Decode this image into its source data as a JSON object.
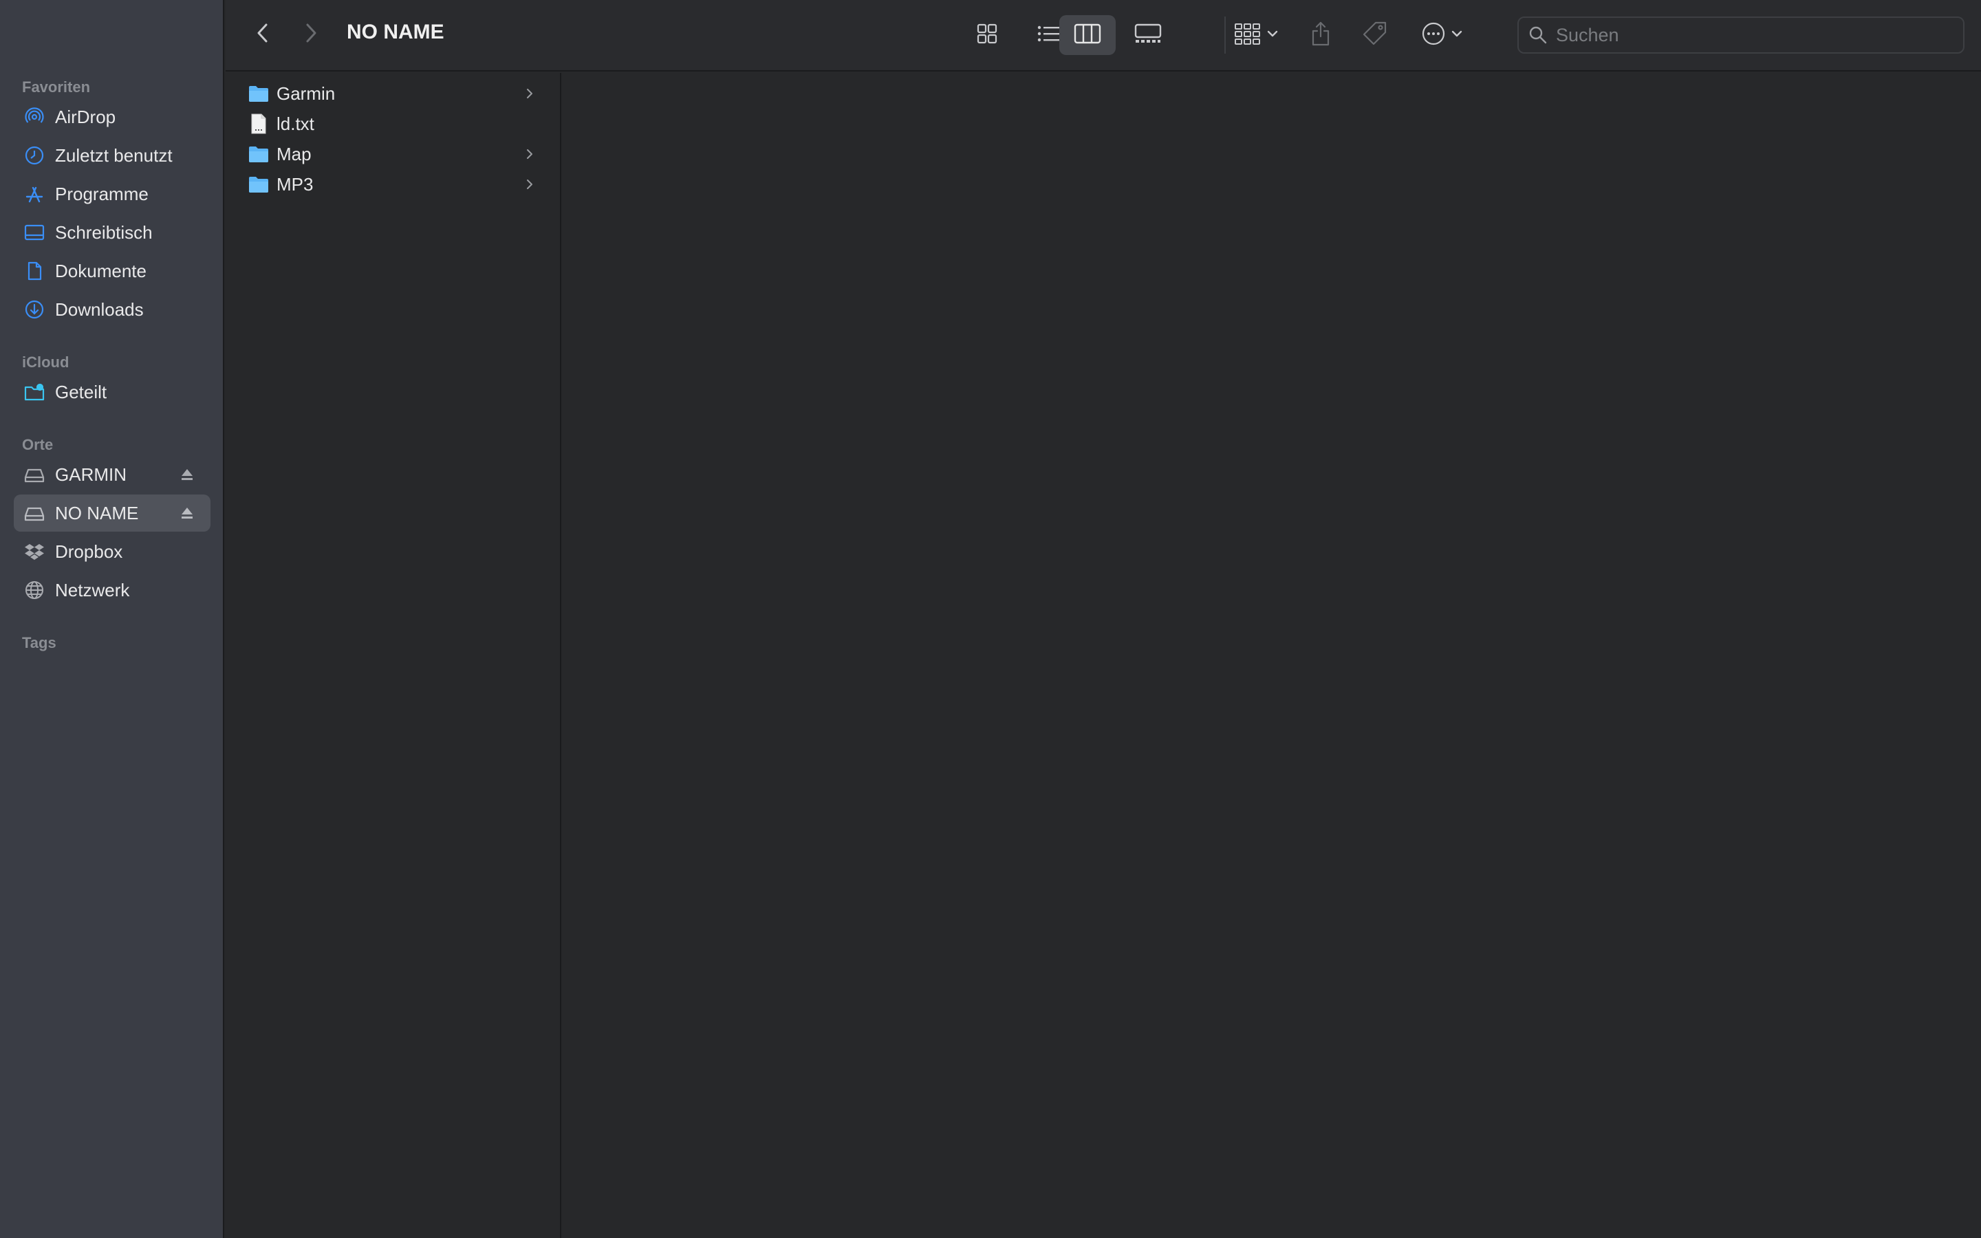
{
  "sidebar": {
    "sections": [
      {
        "title": "Favoriten"
      },
      {
        "title": "iCloud"
      },
      {
        "title": "Orte"
      },
      {
        "title": "Tags"
      }
    ],
    "favorites": [
      {
        "label": "AirDrop",
        "icon": "airdrop-icon"
      },
      {
        "label": "Zuletzt benutzt",
        "icon": "clock-icon"
      },
      {
        "label": "Programme",
        "icon": "apps-icon"
      },
      {
        "label": "Schreibtisch",
        "icon": "desktop-icon"
      },
      {
        "label": "Dokumente",
        "icon": "document-icon"
      },
      {
        "label": "Downloads",
        "icon": "download-icon"
      }
    ],
    "icloud": [
      {
        "label": "Geteilt",
        "icon": "shared-folder-icon"
      }
    ],
    "locations": [
      {
        "label": "GARMIN",
        "icon": "drive-icon",
        "ejectable": true
      },
      {
        "label": "NO NAME",
        "icon": "drive-icon",
        "ejectable": true,
        "selected": true
      },
      {
        "label": "Dropbox",
        "icon": "dropbox-icon"
      },
      {
        "label": "Netzwerk",
        "icon": "network-icon"
      }
    ]
  },
  "toolbar": {
    "title": "NO NAME",
    "active_view": "columns",
    "search_placeholder": "Suchen"
  },
  "files": [
    {
      "name": "Garmin",
      "type": "folder"
    },
    {
      "name": "ld.txt",
      "type": "text-file"
    },
    {
      "name": "Map",
      "type": "folder"
    },
    {
      "name": "MP3",
      "type": "folder"
    }
  ],
  "colors": {
    "accent": "#3a8ef6",
    "folder": "#5bb4f5",
    "sidebar_bg": "#3a3d45",
    "window_bg": "#27282a"
  }
}
